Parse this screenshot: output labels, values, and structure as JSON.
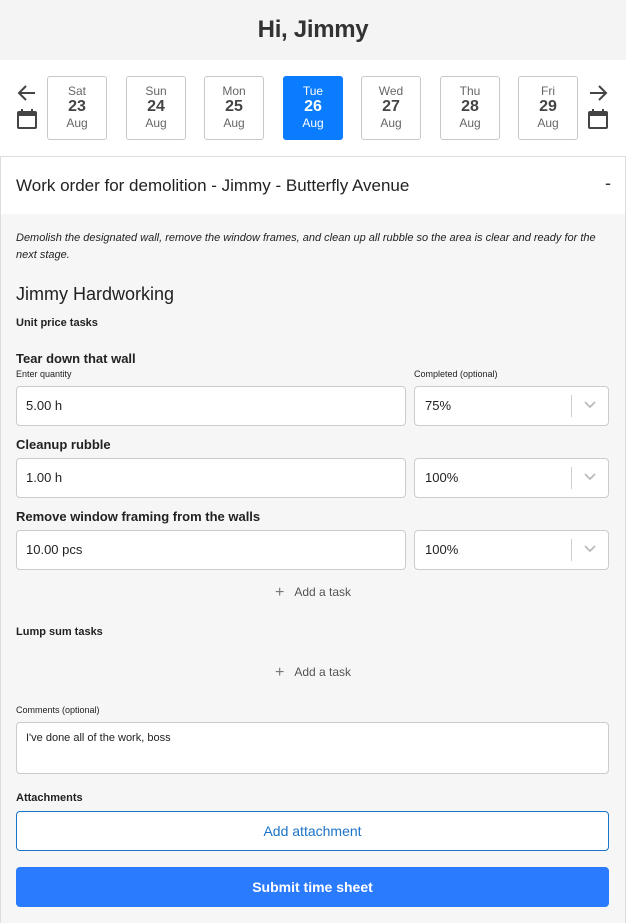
{
  "header": {
    "greeting": "Hi, Jimmy"
  },
  "dates": [
    {
      "day": "Sat",
      "num": "23",
      "month": "Aug",
      "selected": false
    },
    {
      "day": "Sun",
      "num": "24",
      "month": "Aug",
      "selected": false
    },
    {
      "day": "Mon",
      "num": "25",
      "month": "Aug",
      "selected": false
    },
    {
      "day": "Tue",
      "num": "26",
      "month": "Aug",
      "selected": true
    },
    {
      "day": "Wed",
      "num": "27",
      "month": "Aug",
      "selected": false
    },
    {
      "day": "Thu",
      "num": "28",
      "month": "Aug",
      "selected": false
    },
    {
      "day": "Fri",
      "num": "29",
      "month": "Aug",
      "selected": false
    }
  ],
  "icons": {
    "prev": "arrow-left-icon",
    "next": "arrow-right-icon",
    "calendar": "calendar-icon",
    "chevron": "chevron-down-icon",
    "plus": "plus-icon"
  },
  "colors": {
    "accent": "#0a7cff",
    "primary_button": "#2b7bff",
    "outline_button": "#1a73c8"
  },
  "work_order": {
    "title": "Work order for demolition - Jimmy - Butterfly Avenue",
    "collapse_symbol": "-",
    "description": "Demolish the designated wall, remove the window frames, and clean up all rubble so the area is clear and ready for the next stage.",
    "worker": "Jimmy Hardworking",
    "unit_price_label": "Unit price tasks",
    "quantity_label": "Enter quantity",
    "completed_label": "Completed (optional)",
    "tasks": [
      {
        "name": "Tear down that wall",
        "quantity": "5.00 h",
        "completed": "75%"
      },
      {
        "name": "Cleanup rubble",
        "quantity": "1.00 h",
        "completed": "100%"
      },
      {
        "name": "Remove window framing from the walls",
        "quantity": "10.00 pcs",
        "completed": "100%"
      }
    ],
    "add_task_label": "Add a task",
    "lump_sum_label": "Lump sum tasks",
    "comments_label": "Comments (optional)",
    "comment_value": "I've done all of the work, boss",
    "attachments_label": "Attachments",
    "add_attachment_label": "Add attachment",
    "submit_label": "Submit time sheet"
  }
}
